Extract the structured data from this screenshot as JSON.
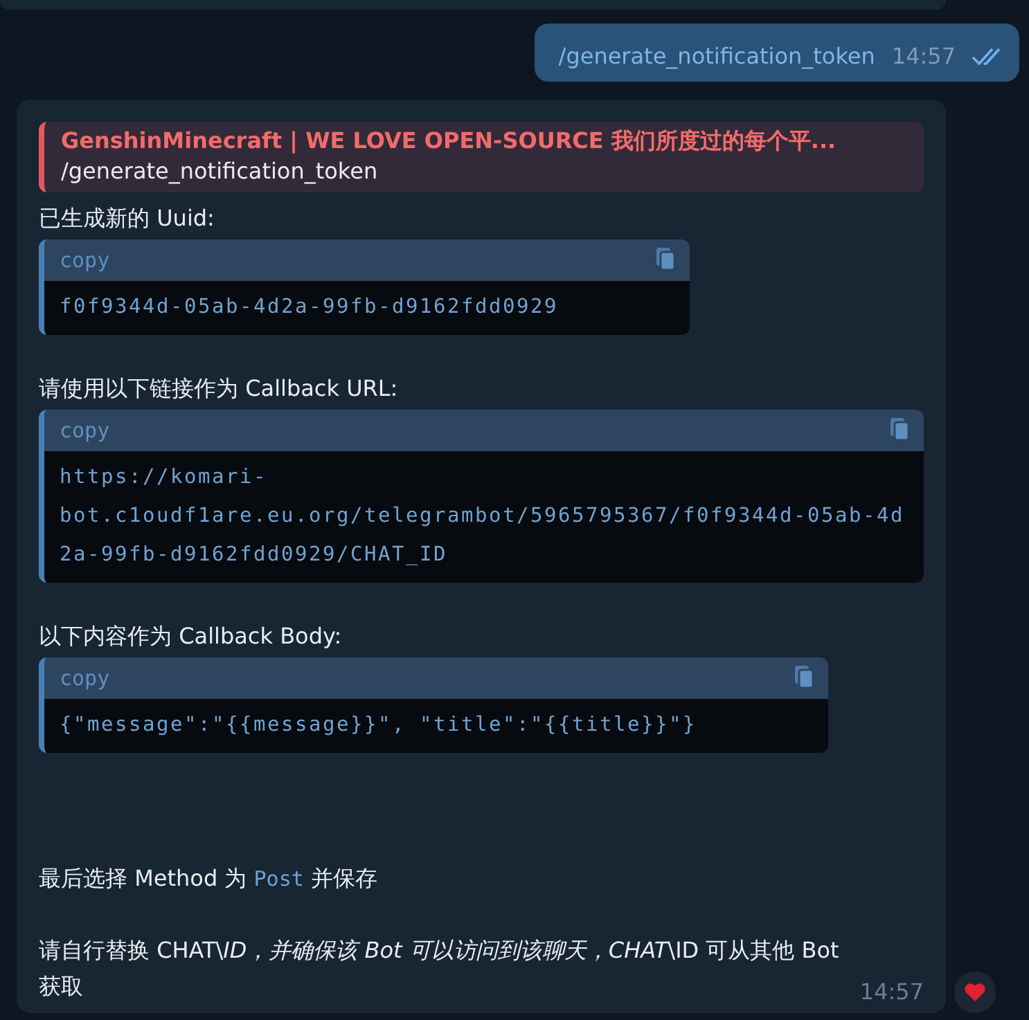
{
  "outgoing": {
    "text": "/generate_notification_token",
    "time": "14:57",
    "read": true
  },
  "incoming": {
    "reply": {
      "author": "GenshinMinecraft | WE LOVE OPEN-SOURCE 我们所度过的每个平...",
      "text": "/generate_notification_token"
    },
    "blocks": [
      {
        "kind": "text",
        "text": "已生成新的 Uuid:"
      },
      {
        "kind": "code",
        "header": "copy",
        "lines": [
          "f0f9344d-05ab-4d2a-99fb-d9162fdd0929"
        ]
      },
      {
        "kind": "gap"
      },
      {
        "kind": "text",
        "text": "请使用以下链接作为 Callback URL:"
      },
      {
        "kind": "code",
        "header": "copy",
        "lines": [
          "https://komari-",
          "bot.c1oudf1are.eu.org/telegrambot/5965795367/f0f9344d-05ab-4d",
          "2a-99fb-d9162fdd0929/CHAT_ID"
        ]
      },
      {
        "kind": "gap"
      },
      {
        "kind": "text",
        "text": "以下内容作为 Callback Body:"
      },
      {
        "kind": "code",
        "header": "copy",
        "lines": [
          "{\"message\":\"{{message}}\", \"title\":\"{{title}}\"}"
        ]
      },
      {
        "kind": "gap"
      },
      {
        "kind": "gap"
      },
      {
        "kind": "gap"
      },
      {
        "kind": "mixed",
        "parts": [
          {
            "kind": "text",
            "text": "最后选择 Method 为"
          },
          {
            "kind": "code",
            "text": "Post"
          },
          {
            "kind": "text",
            "text": "并保存"
          }
        ]
      },
      {
        "kind": "gap"
      },
      {
        "kind": "text",
        "text": "请自行替换 CHAT\\*ID，并确保该 Bot 可以访问到该聊天，CHAT*\\ID 可从其他 Bot 获取"
      }
    ],
    "time": "14:57",
    "reaction": {
      "liked": true
    }
  }
}
